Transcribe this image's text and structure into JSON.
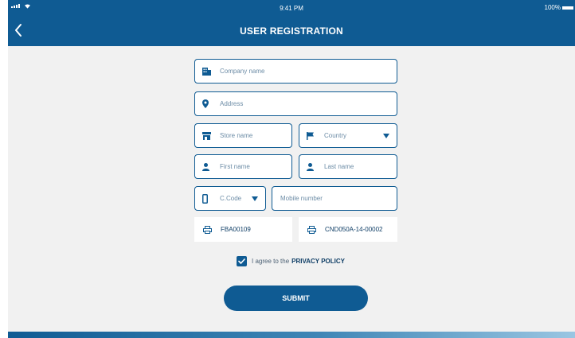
{
  "status_bar": {
    "time": "9:41 PM",
    "battery": "100%"
  },
  "header": {
    "title": "USER REGISTRATION",
    "back_icon": "chevron-left-icon"
  },
  "form": {
    "company_name": {
      "placeholder": "Company name",
      "icon": "building-icon"
    },
    "address": {
      "placeholder": "Address",
      "icon": "location-pin-icon"
    },
    "store_name": {
      "placeholder": "Store name",
      "icon": "store-icon"
    },
    "country": {
      "placeholder": "Country",
      "icon": "flag-icon"
    },
    "first_name": {
      "placeholder": "First name",
      "icon": "person-icon"
    },
    "last_name": {
      "placeholder": "Last name",
      "icon": "person-icon"
    },
    "country_code": {
      "placeholder": "C.Code",
      "icon": "phone-icon"
    },
    "mobile_number": {
      "placeholder": "Mobile number"
    },
    "device_id_1": {
      "value": "FBA00109",
      "icon": "printer-icon"
    },
    "device_id_2": {
      "value": "CND050A-14-00002",
      "icon": "printer-icon"
    }
  },
  "agreement": {
    "checked": true,
    "text": "I agree to the",
    "link": "PRIVACY POLICY"
  },
  "submit_label": "SUBMIT",
  "colors": {
    "primary": "#0f5b93",
    "background": "#f1f1f1",
    "placeholder": "#6c8ca6"
  }
}
